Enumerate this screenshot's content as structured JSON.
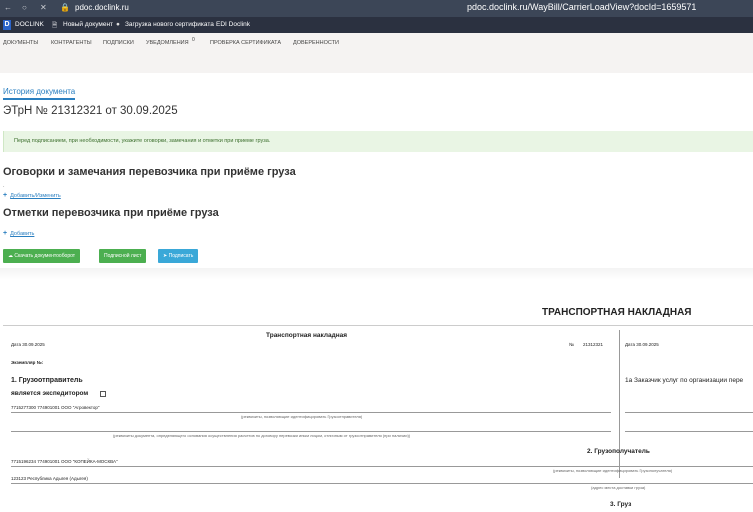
{
  "browser": {
    "host": "pdoc.doclink.ru",
    "url": "pdoc.doclink.ru/WayBill/CarrierLoadView?docId=1659571"
  },
  "bookmarks": {
    "app_logo": "D",
    "items": [
      "DOCLINK",
      "Новый документ",
      "Загрузка нового сертификата",
      "EDI Doclink"
    ]
  },
  "app_nav": {
    "items": [
      "ДОКУМЕНТЫ",
      "КОНТРАГЕНТЫ",
      "ПОДПИСКИ",
      "УВЕДОМЛЕНИЯ",
      "ПРОВЕРКА СЕРТИФИКАТА",
      "ДОВЕРЕННОСТИ"
    ],
    "notifications_count": "0"
  },
  "page": {
    "history_tab": "История документа",
    "doc_title": "ЭТрН №  21312321  от  30.09.2025",
    "notice": "Перед подписанием, при необходимости, укажите оговорки, замечания и отметки при приеме груза.",
    "section1_title": "Оговорки и замечания перевозчика при приёме груза",
    "section1_dot": ".",
    "section1_link": "Добавить/Изменить",
    "section2_title": "Отметки перевозчика при приёме груза",
    "section2_link": "Добавить",
    "buttons": {
      "download": "Скачать документооборот",
      "sign_sheet": "Подписной лист",
      "sign": "Подписать"
    }
  },
  "document": {
    "header_title": "ТРАНСПОРТНАЯ НАКЛАДНАЯ",
    "form_title": "Транспортная накладная",
    "date_left": "Дата  30.09.2025",
    "number_label": "№",
    "number_value": "21312321",
    "date_right": "Дата 30.09.2025",
    "copy_label": "Экземпляр №:",
    "shipper_title": "1. Грузоотправитель",
    "forwarder_label": "является экспедитором",
    "shipper_value": "7715277300 774901001 ООО \"Агровектор\"",
    "shipper_caption": "(реквизиты, позволяющие идентифицировать Грузоотправителя)",
    "basis_caption": "(реквизиты документа, определяющего основания осуществления расчетов по договору перевозки иным лицом, отличным от грузоотправителя (при наличии))",
    "customer_label": "1а Заказчик услуг по организации пере",
    "consignee_title": "2. Грузополучатель",
    "consignee_value": "7715196234 774901001 ООО \"КОПЕЙКА-МОСКВА\"",
    "consignee_caption": "(реквизиты, позволяющие идентифицировать Грузополучателя)",
    "delivery_address": "123123 Республика Адыгея (Адыгея)",
    "delivery_caption": "(адрес места доставки груза)",
    "cargo_title": "3. Груз"
  }
}
